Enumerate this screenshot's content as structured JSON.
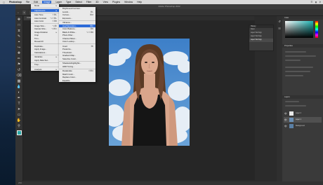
{
  "mac_menubar": {
    "app": "Photoshop",
    "items": [
      "File",
      "Edit",
      "Image",
      "Layer",
      "Type",
      "Select",
      "Filter",
      "3D",
      "View",
      "Plugins",
      "Window",
      "Help"
    ],
    "active_index": 2
  },
  "window": {
    "title": "Adobe Photoshop 2022"
  },
  "doc_tabs": [
    "Untitled-1",
    "portrait.jpg",
    "Untitled-2",
    "Untitled-3"
  ],
  "image_menu": {
    "items": [
      {
        "label": "Mode",
        "sc": "▸"
      },
      {
        "sep": true
      },
      {
        "label": "Adjustments",
        "sc": "▸",
        "hl": true
      },
      {
        "sep": true
      },
      {
        "label": "Auto Tone",
        "sc": "⇧⌘L"
      },
      {
        "label": "Auto Contrast",
        "sc": "⌥⇧⌘L"
      },
      {
        "label": "Auto Color",
        "sc": "⇧⌘B"
      },
      {
        "sep": true
      },
      {
        "label": "Image Size...",
        "sc": "⌥⌘I"
      },
      {
        "label": "Canvas Size...",
        "sc": "⌥⌘C"
      },
      {
        "label": "Image Rotation",
        "sc": "▸"
      },
      {
        "label": "Crop",
        "sc": ""
      },
      {
        "label": "Trim...",
        "sc": ""
      },
      {
        "label": "Reveal All",
        "sc": ""
      },
      {
        "sep": true
      },
      {
        "label": "Duplicate...",
        "sc": ""
      },
      {
        "label": "Apply Image...",
        "sc": ""
      },
      {
        "label": "Calculations...",
        "sc": ""
      },
      {
        "sep": true
      },
      {
        "label": "Variables",
        "sc": "▸"
      },
      {
        "label": "Apply Data Set...",
        "sc": ""
      },
      {
        "sep": true
      },
      {
        "label": "Trap...",
        "sc": ""
      },
      {
        "sep": true
      },
      {
        "label": "Analysis",
        "sc": "▸"
      }
    ]
  },
  "adjustments_menu": {
    "items": [
      {
        "label": "Brightness/Contrast...",
        "sc": ""
      },
      {
        "label": "Levels...",
        "sc": "⌘L"
      },
      {
        "label": "Curves...",
        "sc": "⌘M"
      },
      {
        "label": "Exposure...",
        "sc": ""
      },
      {
        "sep": true
      },
      {
        "label": "Vibrance...",
        "sc": ""
      },
      {
        "label": "Hue/Saturation...",
        "sc": "⌘U",
        "hl": true
      },
      {
        "label": "Color Balance...",
        "sc": "⌘B"
      },
      {
        "label": "Black & White...",
        "sc": "⌥⇧⌘B"
      },
      {
        "label": "Photo Filter...",
        "sc": ""
      },
      {
        "label": "Channel Mixer...",
        "sc": ""
      },
      {
        "label": "Color Lookup...",
        "sc": ""
      },
      {
        "sep": true
      },
      {
        "label": "Invert",
        "sc": "⌘I"
      },
      {
        "label": "Posterize...",
        "sc": ""
      },
      {
        "label": "Threshold...",
        "sc": ""
      },
      {
        "label": "Gradient Map...",
        "sc": ""
      },
      {
        "label": "Selective Color...",
        "sc": ""
      },
      {
        "sep": true
      },
      {
        "label": "Shadows/Highlights...",
        "sc": ""
      },
      {
        "label": "HDR Toning...",
        "sc": ""
      },
      {
        "sep": true
      },
      {
        "label": "Desaturate",
        "sc": "⇧⌘U"
      },
      {
        "label": "Match Color...",
        "sc": ""
      },
      {
        "label": "Replace Color...",
        "sc": ""
      },
      {
        "label": "Equalize",
        "sc": ""
      }
    ]
  },
  "panels": {
    "color": "Color",
    "properties": "Properties",
    "layers": "Layers",
    "history": "History"
  },
  "history_items": [
    "Open",
    "Layer Via Copy",
    "Layer Via Copy",
    "Layer Via Copy"
  ],
  "layers": [
    "Layer 2",
    "Layer 1",
    "Background"
  ],
  "status": "25%",
  "colors": {
    "accent": "#2d6bd8",
    "ui_dark": "#2b2b2b"
  }
}
